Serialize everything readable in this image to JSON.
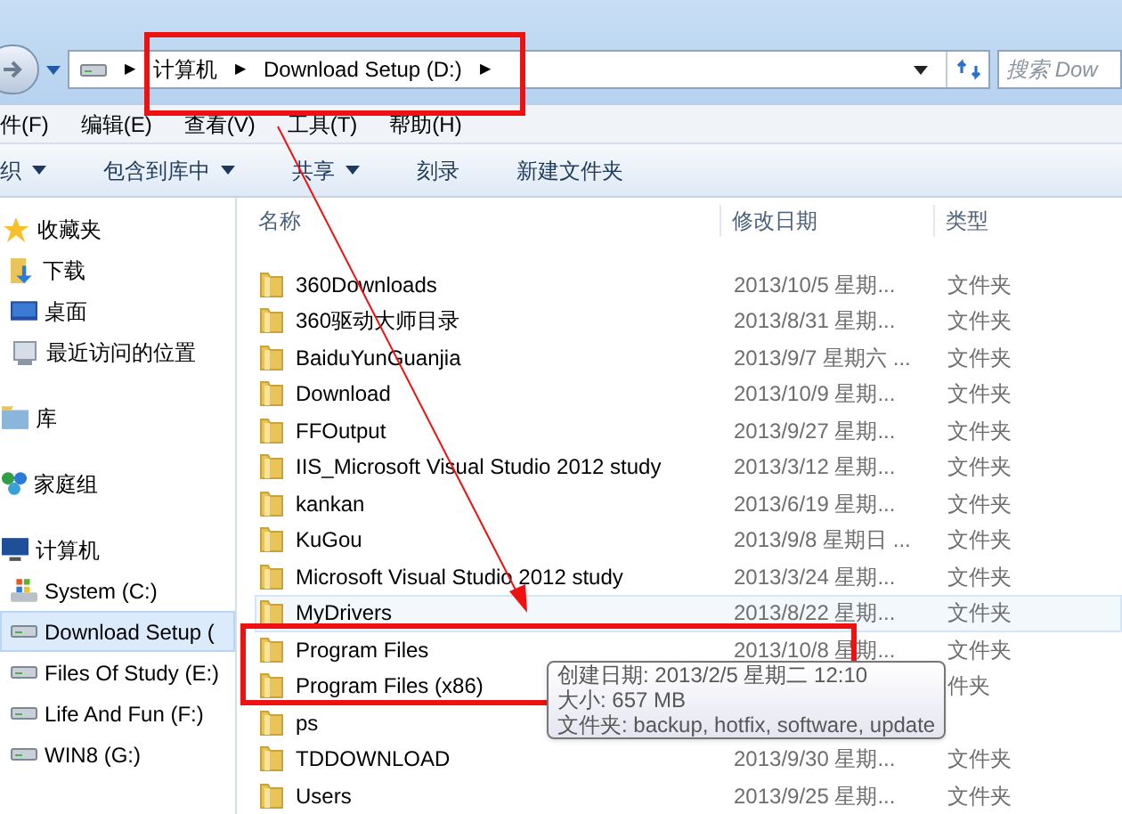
{
  "address_bar": {
    "crumbs": [
      "计算机",
      "Download Setup (D:)"
    ],
    "separator": "▶",
    "search_placeholder": "搜索 Dow"
  },
  "menu": [
    "件(F)",
    "编辑(E)",
    "查看(V)",
    "工具(T)",
    "帮助(H)"
  ],
  "toolbar": [
    {
      "label": "织",
      "dropdown": true
    },
    {
      "label": "包含到库中",
      "dropdown": true
    },
    {
      "label": "共享",
      "dropdown": true
    },
    {
      "label": "刻录",
      "dropdown": false
    },
    {
      "label": "新建文件夹",
      "dropdown": false
    }
  ],
  "sidebar": [
    {
      "label": "收藏夹",
      "selected": false,
      "children": [
        {
          "label": "下载",
          "selected": false
        },
        {
          "label": "桌面",
          "selected": false
        },
        {
          "label": "最近访问的位置",
          "selected": false
        }
      ]
    },
    {
      "label": "库",
      "selected": false
    },
    {
      "label": "家庭组",
      "selected": false
    },
    {
      "label": "计算机",
      "selected": false,
      "children": [
        {
          "label": "System (C:)",
          "selected": false
        },
        {
          "label": "Download Setup (",
          "selected": true
        },
        {
          "label": "Files Of Study (E:)",
          "selected": false
        },
        {
          "label": "Life And Fun (F:)",
          "selected": false
        },
        {
          "label": "WIN8 (G:)",
          "selected": false
        }
      ]
    }
  ],
  "table": {
    "columns": [
      "名称",
      "修改日期",
      "类型"
    ],
    "rows": [
      {
        "name": "360Downloads",
        "date": "2013/10/5 星期...",
        "type": "文件夹",
        "hovered": false
      },
      {
        "name": "360驱动大师目录",
        "date": "2013/8/31 星期...",
        "type": "文件夹",
        "hovered": false
      },
      {
        "name": "BaiduYunGuanjia",
        "date": "2013/9/7 星期六 ...",
        "type": "文件夹",
        "hovered": false
      },
      {
        "name": "Download",
        "date": "2013/10/9 星期...",
        "type": "文件夹",
        "hovered": false
      },
      {
        "name": "FFOutput",
        "date": "2013/9/27 星期...",
        "type": "文件夹",
        "hovered": false
      },
      {
        "name": "IIS_Microsoft Visual Studio 2012 study",
        "date": "2013/3/12 星期...",
        "type": "文件夹",
        "hovered": false
      },
      {
        "name": "kankan",
        "date": "2013/6/19 星期...",
        "type": "文件夹",
        "hovered": false
      },
      {
        "name": "KuGou",
        "date": "2013/9/8 星期日 ...",
        "type": "文件夹",
        "hovered": false
      },
      {
        "name": "Microsoft Visual Studio 2012 study",
        "date": "2013/3/24 星期...",
        "type": "文件夹",
        "hovered": false
      },
      {
        "name": "MyDrivers",
        "date": "2013/8/22 星期...",
        "type": "文件夹",
        "hovered": true
      },
      {
        "name": "Program Files",
        "date": "2013/10/8 星期...",
        "type": "文件夹",
        "hovered": false
      },
      {
        "name": "Program Files (x86)",
        "type": "件夹",
        "hovered": false
      },
      {
        "name": "ps",
        "hovered": false
      },
      {
        "name": "TDDOWNLOAD",
        "date": "2013/9/30 星期...",
        "type": "文件夹",
        "hovered": false
      },
      {
        "name": "Users",
        "date": "2013/9/25 星期...",
        "type": "文件夹",
        "hovered": false
      }
    ]
  },
  "tooltip": [
    "创建日期: 2013/2/5 星期二 12:10",
    "大小: 657 MB",
    "文件夹: backup, hotfix, software, update"
  ]
}
